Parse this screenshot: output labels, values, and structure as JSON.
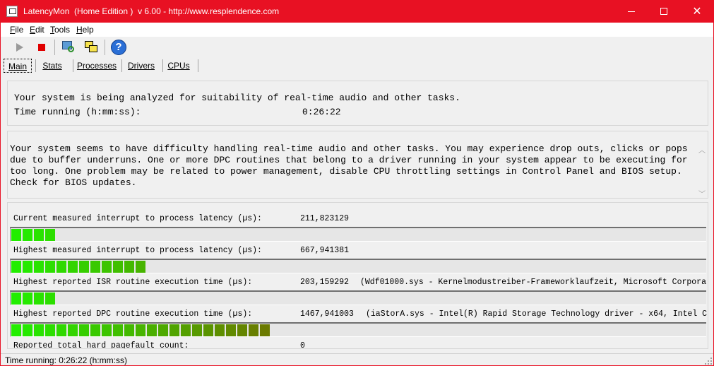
{
  "window": {
    "title": "LatencyMon  (Home Edition )  v 6.00 - http://www.resplendence.com",
    "controls": {
      "minimize": "—",
      "maximize": "☐",
      "close": "✕"
    },
    "accent_color": "#e81123"
  },
  "menu": [
    "File",
    "Edit",
    "Tools",
    "Help"
  ],
  "toolbar": [
    "play-icon",
    "stop-icon",
    "monitor-icon",
    "windows-icon",
    "help-icon"
  ],
  "tabs": [
    "Main",
    "Stats",
    "Processes",
    "Drivers",
    "CPUs"
  ],
  "active_tab": "Main",
  "analysis": {
    "status_line": "Your system is being analyzed for suitability of real-time audio and other tasks.",
    "time_label": "Time running (h:mm:ss):",
    "time_value": "0:26:22"
  },
  "verdict": "Your system seems to have difficulty handling real-time audio and other tasks. You may experience drop outs, clicks or pops due to buffer underruns. One or more DPC routines that belong to a driver running in your system appear to be executing for too long. One problem may be related to power management, disable CPU throttling settings in Control Panel and BIOS setup. Check for BIOS updates.",
  "metrics": [
    {
      "label": "Current measured interrupt to process latency (µs):",
      "value": "211,823129",
      "detail": "",
      "bar_segments": 4
    },
    {
      "label": "Highest measured interrupt to process latency (µs):",
      "value": "667,941381",
      "detail": "",
      "bar_segments": 12
    },
    {
      "label": "Highest reported ISR routine execution time (µs):",
      "value": "203,159292",
      "detail": "(Wdf01000.sys - Kernelmodustreiber-Frameworklaufzeit, Microsoft Corpora",
      "bar_segments": 4
    },
    {
      "label": "Highest reported DPC routine execution time (µs):",
      "value": "1467,941003",
      "detail": "(iaStorA.sys - Intel(R) Rapid Storage Technology driver - x64, Intel C",
      "bar_segments": 23
    },
    {
      "label": "Reported total hard pagefault count:",
      "value": "0",
      "detail": "",
      "bar_segments": 0
    }
  ],
  "colors": {
    "meter_green": "#22ee00",
    "meter_olive": "#6b7a00"
  },
  "statusbar": {
    "text": "Time running: 0:26:22  (h:mm:ss)"
  }
}
